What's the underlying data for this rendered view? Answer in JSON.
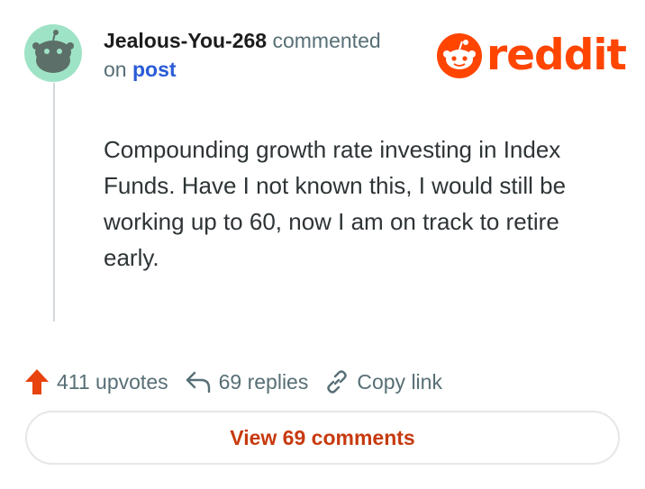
{
  "comment": {
    "username": "Jealous-You-268",
    "action_text": "commented",
    "on_text": "on",
    "post_link_text": "post",
    "body": "Compounding growth rate investing in Index Funds. Have I not known this, I would still be working up to 60, now I am on track to retire early."
  },
  "brand": {
    "logo_text": "reddit",
    "accent_color": "#ff4500",
    "link_color": "#2a5bd7"
  },
  "actions": {
    "upvotes_label": "411 upvotes",
    "replies_label": "69 replies",
    "copy_link_label": "Copy link",
    "upvote_icon": "upvote-arrow-icon",
    "reply_icon": "reply-arrow-icon",
    "link_icon": "link-icon"
  },
  "footer": {
    "view_comments_label": "View 69 comments"
  }
}
